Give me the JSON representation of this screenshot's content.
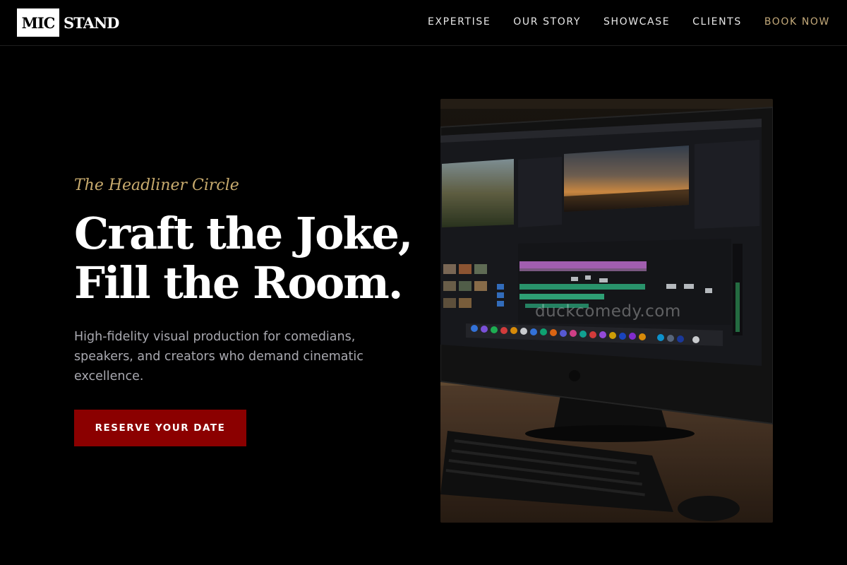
{
  "brand": {
    "logo_box_text": "MIC",
    "logo_text": "STAND"
  },
  "nav": {
    "items": [
      {
        "label": "EXPERTISE",
        "accent": false
      },
      {
        "label": "OUR STORY",
        "accent": false
      },
      {
        "label": "SHOWCASE",
        "accent": false
      },
      {
        "label": "CLIENTS",
        "accent": false
      },
      {
        "label": "BOOK NOW",
        "accent": true
      }
    ]
  },
  "hero": {
    "eyebrow": "The Headliner Circle",
    "headline_line1": "Craft the Joke,",
    "headline_line2": "Fill the Room.",
    "lead": "High-fidelity visual production for comedians, speakers, and creators who demand cinematic excellence.",
    "cta_label": "RESERVE YOUR DATE"
  },
  "image": {
    "subject": "video-editing-workstation",
    "watermark": "duckcomedy.com"
  },
  "colors": {
    "background": "#000000",
    "accent_gold": "#c8ab6e",
    "nav_accent": "#c3a97a",
    "cta_red": "#8b0000",
    "lead_gray": "#a9a9b0"
  }
}
